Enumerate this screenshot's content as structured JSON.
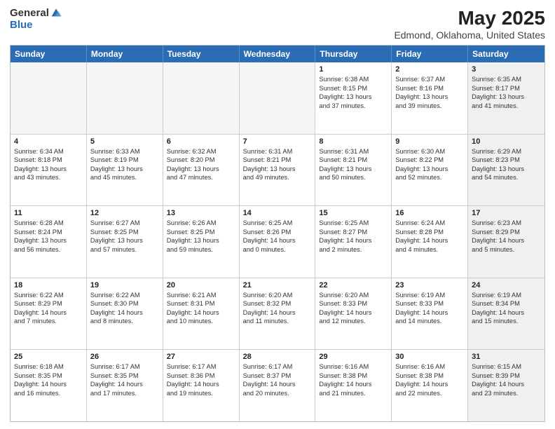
{
  "logo": {
    "general": "General",
    "blue": "Blue"
  },
  "title": "May 2025",
  "subtitle": "Edmond, Oklahoma, United States",
  "days": [
    "Sunday",
    "Monday",
    "Tuesday",
    "Wednesday",
    "Thursday",
    "Friday",
    "Saturday"
  ],
  "rows": [
    [
      {
        "num": "",
        "lines": [],
        "empty": true
      },
      {
        "num": "",
        "lines": [],
        "empty": true
      },
      {
        "num": "",
        "lines": [],
        "empty": true
      },
      {
        "num": "",
        "lines": [],
        "empty": true
      },
      {
        "num": "1",
        "lines": [
          "Sunrise: 6:38 AM",
          "Sunset: 8:15 PM",
          "Daylight: 13 hours",
          "and 37 minutes."
        ]
      },
      {
        "num": "2",
        "lines": [
          "Sunrise: 6:37 AM",
          "Sunset: 8:16 PM",
          "Daylight: 13 hours",
          "and 39 minutes."
        ]
      },
      {
        "num": "3",
        "lines": [
          "Sunrise: 6:35 AM",
          "Sunset: 8:17 PM",
          "Daylight: 13 hours",
          "and 41 minutes."
        ],
        "shaded": true
      }
    ],
    [
      {
        "num": "4",
        "lines": [
          "Sunrise: 6:34 AM",
          "Sunset: 8:18 PM",
          "Daylight: 13 hours",
          "and 43 minutes."
        ]
      },
      {
        "num": "5",
        "lines": [
          "Sunrise: 6:33 AM",
          "Sunset: 8:19 PM",
          "Daylight: 13 hours",
          "and 45 minutes."
        ]
      },
      {
        "num": "6",
        "lines": [
          "Sunrise: 6:32 AM",
          "Sunset: 8:20 PM",
          "Daylight: 13 hours",
          "and 47 minutes."
        ]
      },
      {
        "num": "7",
        "lines": [
          "Sunrise: 6:31 AM",
          "Sunset: 8:21 PM",
          "Daylight: 13 hours",
          "and 49 minutes."
        ]
      },
      {
        "num": "8",
        "lines": [
          "Sunrise: 6:31 AM",
          "Sunset: 8:21 PM",
          "Daylight: 13 hours",
          "and 50 minutes."
        ]
      },
      {
        "num": "9",
        "lines": [
          "Sunrise: 6:30 AM",
          "Sunset: 8:22 PM",
          "Daylight: 13 hours",
          "and 52 minutes."
        ]
      },
      {
        "num": "10",
        "lines": [
          "Sunrise: 6:29 AM",
          "Sunset: 8:23 PM",
          "Daylight: 13 hours",
          "and 54 minutes."
        ],
        "shaded": true
      }
    ],
    [
      {
        "num": "11",
        "lines": [
          "Sunrise: 6:28 AM",
          "Sunset: 8:24 PM",
          "Daylight: 13 hours",
          "and 56 minutes."
        ]
      },
      {
        "num": "12",
        "lines": [
          "Sunrise: 6:27 AM",
          "Sunset: 8:25 PM",
          "Daylight: 13 hours",
          "and 57 minutes."
        ]
      },
      {
        "num": "13",
        "lines": [
          "Sunrise: 6:26 AM",
          "Sunset: 8:25 PM",
          "Daylight: 13 hours",
          "and 59 minutes."
        ]
      },
      {
        "num": "14",
        "lines": [
          "Sunrise: 6:25 AM",
          "Sunset: 8:26 PM",
          "Daylight: 14 hours",
          "and 0 minutes."
        ]
      },
      {
        "num": "15",
        "lines": [
          "Sunrise: 6:25 AM",
          "Sunset: 8:27 PM",
          "Daylight: 14 hours",
          "and 2 minutes."
        ]
      },
      {
        "num": "16",
        "lines": [
          "Sunrise: 6:24 AM",
          "Sunset: 8:28 PM",
          "Daylight: 14 hours",
          "and 4 minutes."
        ]
      },
      {
        "num": "17",
        "lines": [
          "Sunrise: 6:23 AM",
          "Sunset: 8:29 PM",
          "Daylight: 14 hours",
          "and 5 minutes."
        ],
        "shaded": true
      }
    ],
    [
      {
        "num": "18",
        "lines": [
          "Sunrise: 6:22 AM",
          "Sunset: 8:29 PM",
          "Daylight: 14 hours",
          "and 7 minutes."
        ]
      },
      {
        "num": "19",
        "lines": [
          "Sunrise: 6:22 AM",
          "Sunset: 8:30 PM",
          "Daylight: 14 hours",
          "and 8 minutes."
        ]
      },
      {
        "num": "20",
        "lines": [
          "Sunrise: 6:21 AM",
          "Sunset: 8:31 PM",
          "Daylight: 14 hours",
          "and 10 minutes."
        ]
      },
      {
        "num": "21",
        "lines": [
          "Sunrise: 6:20 AM",
          "Sunset: 8:32 PM",
          "Daylight: 14 hours",
          "and 11 minutes."
        ]
      },
      {
        "num": "22",
        "lines": [
          "Sunrise: 6:20 AM",
          "Sunset: 8:33 PM",
          "Daylight: 14 hours",
          "and 12 minutes."
        ]
      },
      {
        "num": "23",
        "lines": [
          "Sunrise: 6:19 AM",
          "Sunset: 8:33 PM",
          "Daylight: 14 hours",
          "and 14 minutes."
        ]
      },
      {
        "num": "24",
        "lines": [
          "Sunrise: 6:19 AM",
          "Sunset: 8:34 PM",
          "Daylight: 14 hours",
          "and 15 minutes."
        ],
        "shaded": true
      }
    ],
    [
      {
        "num": "25",
        "lines": [
          "Sunrise: 6:18 AM",
          "Sunset: 8:35 PM",
          "Daylight: 14 hours",
          "and 16 minutes."
        ]
      },
      {
        "num": "26",
        "lines": [
          "Sunrise: 6:17 AM",
          "Sunset: 8:35 PM",
          "Daylight: 14 hours",
          "and 17 minutes."
        ]
      },
      {
        "num": "27",
        "lines": [
          "Sunrise: 6:17 AM",
          "Sunset: 8:36 PM",
          "Daylight: 14 hours",
          "and 19 minutes."
        ]
      },
      {
        "num": "28",
        "lines": [
          "Sunrise: 6:17 AM",
          "Sunset: 8:37 PM",
          "Daylight: 14 hours",
          "and 20 minutes."
        ]
      },
      {
        "num": "29",
        "lines": [
          "Sunrise: 6:16 AM",
          "Sunset: 8:38 PM",
          "Daylight: 14 hours",
          "and 21 minutes."
        ]
      },
      {
        "num": "30",
        "lines": [
          "Sunrise: 6:16 AM",
          "Sunset: 8:38 PM",
          "Daylight: 14 hours",
          "and 22 minutes."
        ]
      },
      {
        "num": "31",
        "lines": [
          "Sunrise: 6:15 AM",
          "Sunset: 8:39 PM",
          "Daylight: 14 hours",
          "and 23 minutes."
        ],
        "shaded": true
      }
    ]
  ]
}
